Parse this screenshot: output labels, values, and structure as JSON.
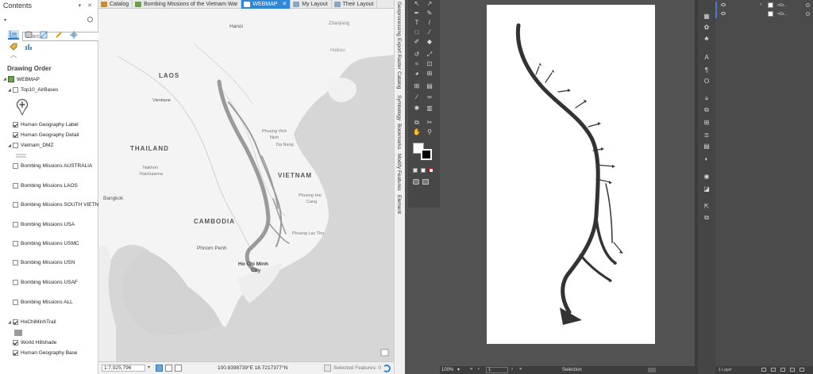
{
  "contents": {
    "title": "Contents",
    "pane_controls": "▾ ✕",
    "search_placeholder": "Search",
    "drawing_order": "Drawing Order",
    "layers": [
      {
        "name": "WEBMAP",
        "checked": true
      },
      {
        "name": "Top10_AirBases",
        "checked": false
      },
      {
        "name": "Human Geography Label",
        "checked": true
      },
      {
        "name": "Human Geography Detail",
        "checked": true
      },
      {
        "name": "Vietnam_DMZ",
        "checked": false
      },
      {
        "name": "Bombing Missions AUSTRALIA",
        "checked": false
      },
      {
        "name": "Bombing Missions LAOS",
        "checked": false
      },
      {
        "name": "Bombing Missions SOUTH VIETNA",
        "checked": false
      },
      {
        "name": "Bombing Missions USA",
        "checked": false
      },
      {
        "name": "Bombing Missions USMC",
        "checked": false
      },
      {
        "name": "Bombing Missions USN",
        "checked": false
      },
      {
        "name": "Bombing Missions USAF",
        "checked": false
      },
      {
        "name": "Bombing Missions ALL",
        "checked": false
      },
      {
        "name": "HoChiMinhTrail",
        "checked": true
      },
      {
        "name": "World Hillshade",
        "checked": true
      },
      {
        "name": "Human Geography Base",
        "checked": true
      }
    ]
  },
  "map_tabs": [
    {
      "label": "Catalog",
      "active": false
    },
    {
      "label": "Bombing Missions of the Vietnam War",
      "active": false
    },
    {
      "label": "WEBMAP",
      "active": true
    },
    {
      "label": "My Layout",
      "active": false
    },
    {
      "label": "Their Layout",
      "active": false
    }
  ],
  "tab_close": "✕",
  "map_labels": {
    "hanoi": "Hanoi",
    "zhanjiang": "Zhanjiang",
    "haikou": "Haikou",
    "laos": "LAOS",
    "vientiane": "Vientiane",
    "thailand": "THAILAND",
    "nakhon": "Nakhon",
    "ratchasima": "Ratchasima",
    "bangkok": "Bangkok",
    "cambodia": "CAMBODIA",
    "phnom_penh": "Phnom Penh",
    "vietnam": "VIETNAM",
    "phuong_vinh": "Phuong Vinh",
    "ninh": "Ninh",
    "da_nang": "Da Nang",
    "phuong_hai": "Phuong Hai",
    "cang": "Cang",
    "phuong_lac_tho": "Phuong Lac Tho",
    "ho_chi_minh": "Ho Chi Minh",
    "city": "City"
  },
  "map_status": {
    "scale": "1:7,925,796",
    "coordinates": "100.8398739°E 18.7217377°N",
    "selected": "Selected Features: 0"
  },
  "side_tabs": [
    "Geoprocessing",
    "Export Raster",
    "Catalog",
    "Symbology",
    "Bookmarks",
    "Modify Features",
    "Element"
  ],
  "illustrator": {
    "zoom": "100%",
    "artboard_num": "1",
    "selection": "Selection",
    "layers_count": "1 Layer",
    "layer_rows": [
      "<Gr...",
      "<Gr..."
    ]
  },
  "colors": {
    "arcgis_active_tab": "#2f87d7",
    "trail": "#9a9a9a",
    "ai_background": "#535353",
    "ai_artwork": "#333333"
  }
}
